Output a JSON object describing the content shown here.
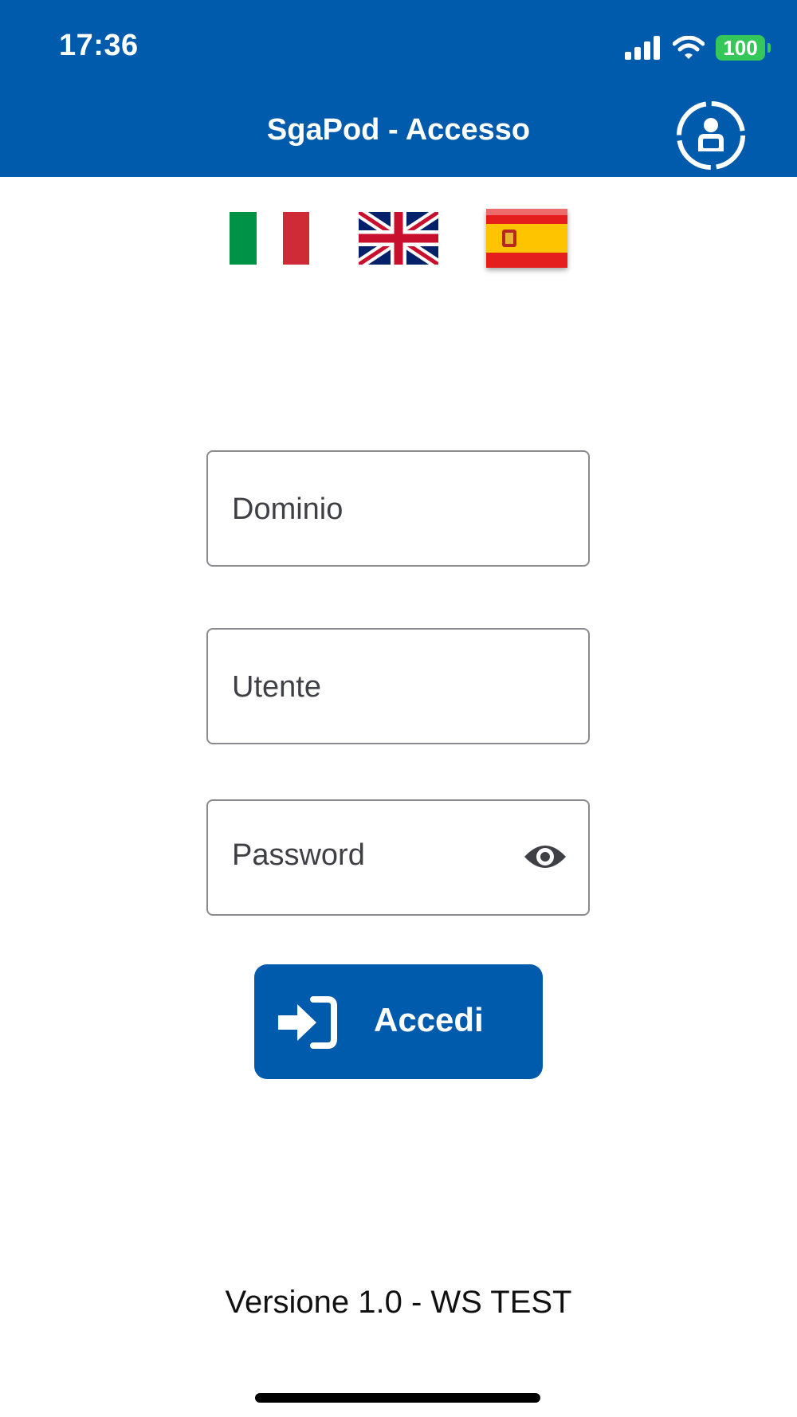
{
  "status_bar": {
    "time": "17:36",
    "battery_level": "100",
    "icons": [
      "cellular-signal-icon",
      "wifi-icon",
      "battery-icon"
    ]
  },
  "header": {
    "title": "SgaPod - Accesso",
    "profile_icon": "user-profile-icon"
  },
  "languages": [
    {
      "code": "it",
      "icon": "italian-flag-icon"
    },
    {
      "code": "en",
      "icon": "uk-flag-icon"
    },
    {
      "code": "es",
      "icon": "spanish-flag-icon"
    }
  ],
  "form": {
    "domain_placeholder": "Dominio",
    "domain_value": "",
    "user_placeholder": "Utente",
    "user_value": "",
    "password_placeholder": "Password",
    "password_value": "",
    "password_toggle_icon": "eye-icon",
    "login_label": "Accedi",
    "login_icon": "sign-in-icon"
  },
  "footer": {
    "version": "Versione 1.0 - WS TEST"
  },
  "colors": {
    "primary": "#005bac",
    "battery": "#35c759",
    "field_border": "#8a8a90",
    "background": "#ffffff"
  }
}
